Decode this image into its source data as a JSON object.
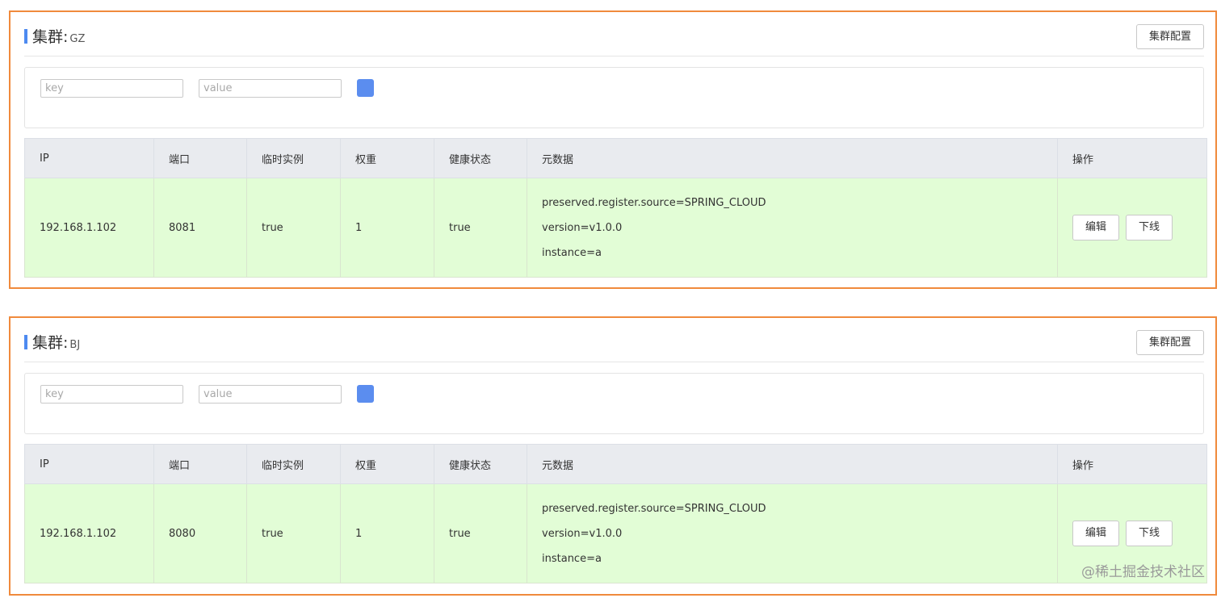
{
  "clusters": [
    {
      "title": "集群:",
      "name": "GZ",
      "config_button": "集群配置",
      "filter": {
        "key_placeholder": "key",
        "value_placeholder": "value"
      },
      "headers": [
        "IP",
        "端口",
        "临时实例",
        "权重",
        "健康状态",
        "元数据",
        "操作"
      ],
      "row": {
        "ip": "192.168.1.102",
        "port": "8081",
        "ephemeral": "true",
        "weight": "1",
        "healthy": "true",
        "metadata": [
          "preserved.register.source=SPRING_CLOUD",
          "version=v1.0.0",
          "instance=a"
        ],
        "edit": "编辑",
        "offline": "下线"
      }
    },
    {
      "title": "集群:",
      "name": "BJ",
      "config_button": "集群配置",
      "filter": {
        "key_placeholder": "key",
        "value_placeholder": "value"
      },
      "headers": [
        "IP",
        "端口",
        "临时实例",
        "权重",
        "健康状态",
        "元数据",
        "操作"
      ],
      "row": {
        "ip": "192.168.1.102",
        "port": "8080",
        "ephemeral": "true",
        "weight": "1",
        "healthy": "true",
        "metadata": [
          "preserved.register.source=SPRING_CLOUD",
          "version=v1.0.0",
          "instance=a"
        ],
        "edit": "编辑",
        "offline": "下线"
      }
    }
  ],
  "watermark": "@稀土掘金技术社区",
  "colors": {
    "border": "#f08a3c",
    "accent": "#4d8af0",
    "row_bg": "#e2fdd6",
    "header_bg": "#e9ebef"
  }
}
